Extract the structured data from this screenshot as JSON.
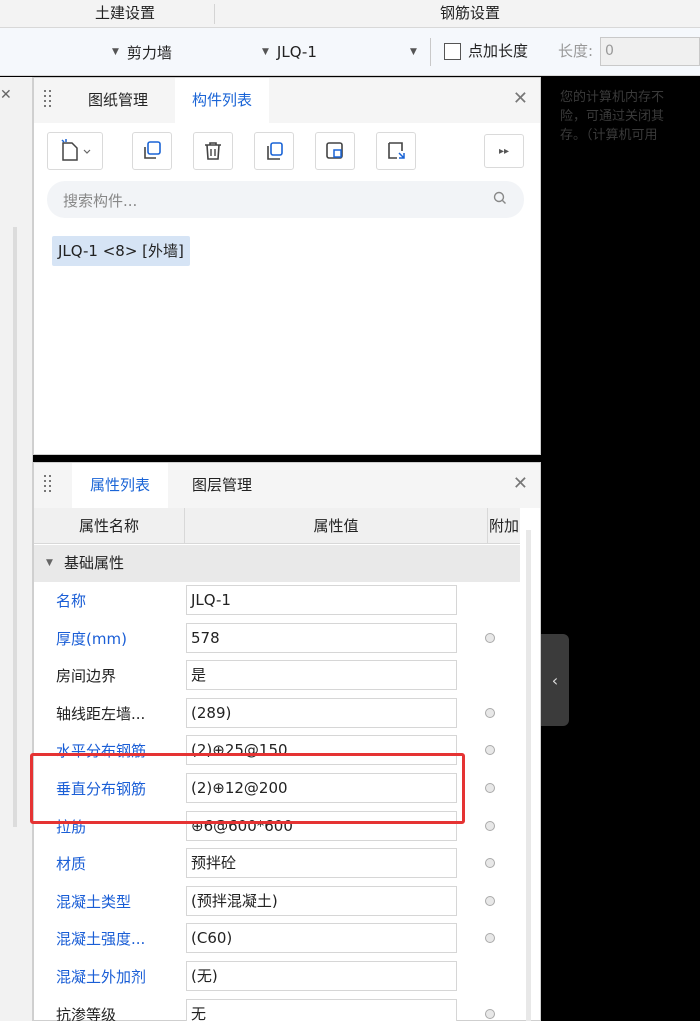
{
  "ribbon": {
    "tab1": "土建设置",
    "tab2": "钢筋设置"
  },
  "toolbar": {
    "combo1": "剪力墙",
    "combo2": "JLQ-1",
    "checkbox_label": "点加长度",
    "length_label": "长度:",
    "length_value": "0"
  },
  "message": {
    "line1": "您的计算机内存不",
    "line2": "险，可通过关闭其",
    "line3": "存。（计算机可用"
  },
  "component_panel": {
    "tab_drawings": "图纸管理",
    "tab_components": "构件列表",
    "search_placeholder": "搜索构件...",
    "item": "JLQ-1 <8> [外墙]"
  },
  "property_panel": {
    "tab_properties": "属性列表",
    "tab_layers": "图层管理",
    "col_name": "属性名称",
    "col_value": "属性值",
    "col_extra": "附加",
    "section": "基础属性",
    "rows": [
      {
        "name": "名称",
        "value": "JLQ-1"
      },
      {
        "name": "厚度(mm)",
        "value": "578"
      },
      {
        "name": "房间边界",
        "value": "是"
      },
      {
        "name": "轴线距左墙...",
        "value": "(289)"
      },
      {
        "name": "水平分布钢筋",
        "value": "(2)⊕25@150"
      },
      {
        "name": "垂直分布钢筋",
        "value": "(2)⊕12@200"
      },
      {
        "name": "拉筋",
        "value": "⊕6@600*600"
      },
      {
        "name": "材质",
        "value": "预拌砼"
      },
      {
        "name": "混凝土类型",
        "value": "(预拌混凝土)"
      },
      {
        "name": "混凝土强度...",
        "value": "(C60)"
      },
      {
        "name": "混凝土外加剂",
        "value": "(无)"
      },
      {
        "name": "抗渗等级",
        "value": "无"
      }
    ]
  },
  "colors": {
    "accent_blue": "#1a64d6",
    "highlight_red": "#e53333"
  }
}
